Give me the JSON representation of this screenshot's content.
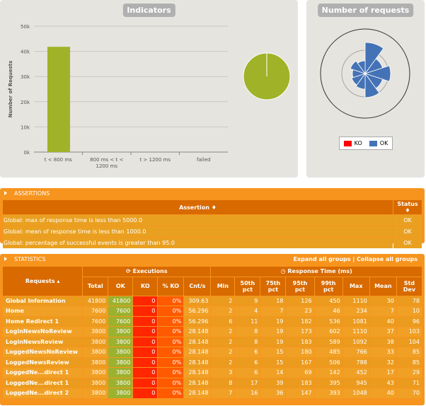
{
  "indicators": {
    "title": "Indicators",
    "ylabel": "Number of Requests",
    "yticks": [
      "50k",
      "40k",
      "30k",
      "20k",
      "10k",
      "0k"
    ],
    "categories": [
      "t < 800 ms",
      "800 ms < t < 1200 ms",
      "t > 1200 ms",
      "failed"
    ],
    "category_lines": [
      [
        "t < 800 ms"
      ],
      [
        "800 ms < t <",
        "1200 ms"
      ],
      [
        "t > 1200 ms"
      ],
      [
        "failed"
      ]
    ]
  },
  "requests_panel": {
    "title": "Number of requests",
    "legend_ko": "KO",
    "legend_ok": "OK"
  },
  "chart_data": [
    {
      "type": "bar",
      "title": "Indicators",
      "ylabel": "Number of Requests",
      "categories": [
        "t < 800 ms",
        "800 ms < t < 1200 ms",
        "t > 1200 ms",
        "failed"
      ],
      "values": [
        41800,
        0,
        0,
        0
      ],
      "ylim": [
        0,
        50000
      ],
      "color": "#a0b328"
    },
    {
      "type": "pie",
      "slices": [
        {
          "name": "t < 800 ms",
          "value": 41800,
          "color": "#a0b328"
        }
      ]
    },
    {
      "type": "pie",
      "title": "Number of requests",
      "series": [
        {
          "name": "OK",
          "color": "#4472b6"
        },
        {
          "name": "KO",
          "color": "#ff0000"
        }
      ]
    }
  ],
  "assertions": {
    "section_label": "ASSERTIONS",
    "col_assertion": "Assertion",
    "col_status": "Status",
    "rows": [
      {
        "text": "Global: max of response time is less than 5000.0",
        "status": "OK"
      },
      {
        "text": "Global: mean of response time is less than 1000.0",
        "status": "OK"
      },
      {
        "text": "Global: percentage of successful events is greater than 95.0",
        "status": "OK"
      }
    ]
  },
  "statistics": {
    "section_label": "STATISTICS",
    "expand_all": "Expand all groups",
    "separator": "|",
    "collapse_all": "Collapse all groups",
    "col_requests": "Requests",
    "executions": "Executions",
    "response_time": "Response Time (ms)",
    "columns": [
      "Total",
      "OK",
      "KO",
      "% KO",
      "Cnt/s",
      "Min",
      "50th pct",
      "75th pct",
      "95th pct",
      "99th pct",
      "Max",
      "Mean",
      "Std Dev"
    ],
    "rows": [
      {
        "name": "Global Information",
        "v": [
          "41800",
          "41800",
          "0",
          "0%",
          "309.63",
          "2",
          "9",
          "18",
          "126",
          "450",
          "1110",
          "30",
          "78"
        ]
      },
      {
        "name": "Home",
        "v": [
          "7600",
          "7600",
          "0",
          "0%",
          "56.296",
          "2",
          "4",
          "7",
          "23",
          "46",
          "234",
          "7",
          "10"
        ]
      },
      {
        "name": "Home Redirect 1",
        "v": [
          "7600",
          "7600",
          "0",
          "0%",
          "56.296",
          "6",
          "11",
          "19",
          "182",
          "536",
          "1081",
          "40",
          "96"
        ]
      },
      {
        "name": "LoginNewsNoReview",
        "v": [
          "3800",
          "3800",
          "0",
          "0%",
          "28.148",
          "2",
          "8",
          "19",
          "173",
          "602",
          "1110",
          "37",
          "103"
        ]
      },
      {
        "name": "LoginNewsReview",
        "v": [
          "3800",
          "3800",
          "0",
          "0%",
          "28.148",
          "2",
          "8",
          "19",
          "183",
          "589",
          "1092",
          "38",
          "104"
        ]
      },
      {
        "name": "LoggedNewsNoReview",
        "v": [
          "3800",
          "3800",
          "0",
          "0%",
          "28.148",
          "2",
          "6",
          "15",
          "180",
          "485",
          "766",
          "33",
          "85"
        ]
      },
      {
        "name": "LoggedNewsReview",
        "v": [
          "3800",
          "3800",
          "0",
          "0%",
          "28.148",
          "2",
          "6",
          "15",
          "167",
          "506",
          "788",
          "32",
          "85"
        ]
      },
      {
        "name": "LoggedNe...direct 1",
        "v": [
          "3800",
          "3800",
          "0",
          "0%",
          "28.148",
          "3",
          "6",
          "14",
          "69",
          "142",
          "452",
          "17",
          "29"
        ]
      },
      {
        "name": "LoggedNe...direct 1",
        "v": [
          "3800",
          "3800",
          "0",
          "0%",
          "28.148",
          "8",
          "17",
          "39",
          "183",
          "395",
          "945",
          "43",
          "71"
        ]
      },
      {
        "name": "LoggedNe...direct 2",
        "v": [
          "3800",
          "3800",
          "0",
          "0%",
          "28.148",
          "7",
          "16",
          "36",
          "147",
          "393",
          "1048",
          "40",
          "70"
        ]
      }
    ]
  }
}
